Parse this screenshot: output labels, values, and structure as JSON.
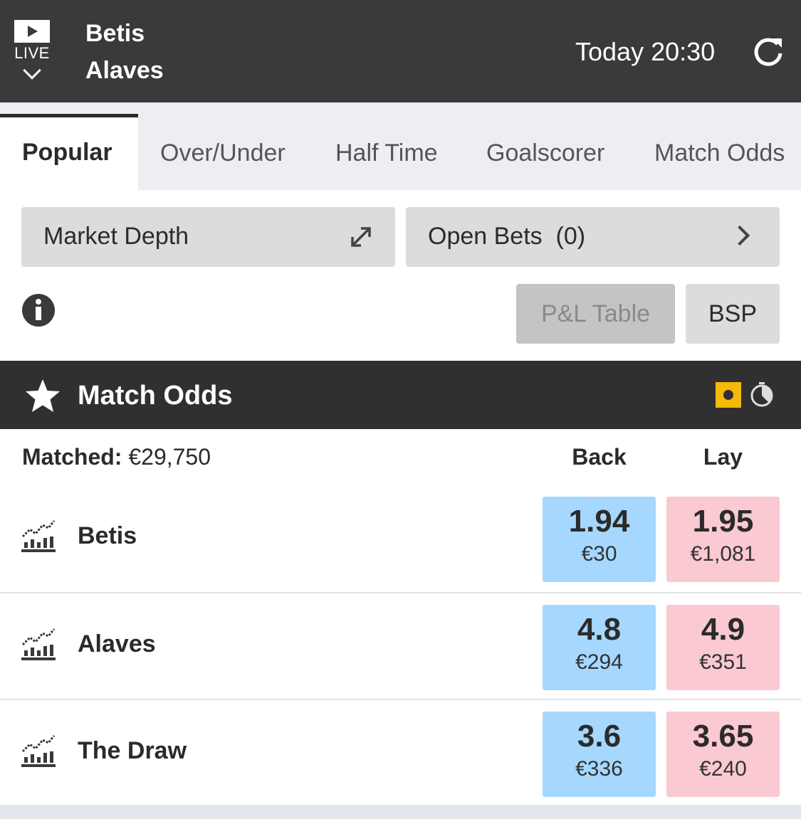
{
  "header": {
    "live_label": "LIVE",
    "home_team": "Betis",
    "away_team": "Alaves",
    "time": "Today 20:30"
  },
  "tabs": [
    {
      "label": "Popular",
      "active": true
    },
    {
      "label": "Over/Under"
    },
    {
      "label": "Half Time"
    },
    {
      "label": "Goalscorer"
    },
    {
      "label": "Match Odds"
    }
  ],
  "toolbar": {
    "market_depth": "Market Depth",
    "open_bets": "Open Bets  (0)",
    "pl_table": "P&L Table",
    "bsp": "BSP"
  },
  "market": {
    "title": "Match Odds",
    "matched_label": "Matched:",
    "matched_value": "€29,750",
    "back_label": "Back",
    "lay_label": "Lay",
    "runners": [
      {
        "name": "Betis",
        "back_odds": "1.94",
        "back_stake": "€30",
        "lay_odds": "1.95",
        "lay_stake": "€1,081"
      },
      {
        "name": "Alaves",
        "back_odds": "4.8",
        "back_stake": "€294",
        "lay_odds": "4.9",
        "lay_stake": "€351"
      },
      {
        "name": "The Draw",
        "back_odds": "3.6",
        "back_stake": "€336",
        "lay_odds": "3.65",
        "lay_stake": "€240"
      }
    ]
  },
  "colors": {
    "header_bg": "#3a3a3a",
    "market_header_bg": "#303030",
    "back": "#a6d8ff",
    "lay": "#fac9d1",
    "inplay_accent": "#f5b90a"
  },
  "icons": [
    "play-icon",
    "chevron-down-icon",
    "refresh-icon",
    "expand-icon",
    "chevron-right-icon",
    "info-icon",
    "star-icon",
    "inplay-icon",
    "timer-icon",
    "chart-icon"
  ]
}
